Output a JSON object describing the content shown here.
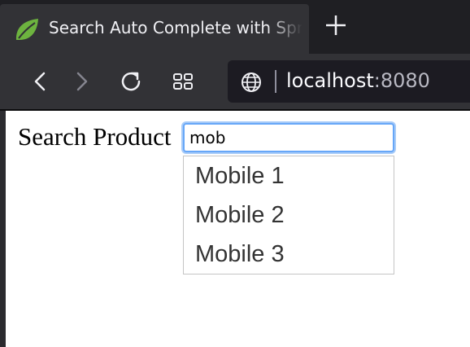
{
  "browser": {
    "tab": {
      "title": "Search Auto Complete with Spring Boot",
      "favicon": "spring-leaf-icon"
    },
    "new_tab_icon": "plus-icon",
    "toolbar": {
      "back_icon": "chevron-left-icon",
      "forward_icon": "chevron-right-icon",
      "reload_icon": "reload-icon",
      "overview_icon": "grid-icon"
    },
    "url": {
      "host": "localhost",
      "port": ":8080",
      "site_icon": "globe-icon"
    }
  },
  "page": {
    "label": "Search Product",
    "search": {
      "value": "mob"
    },
    "suggestions": [
      "Mobile 1",
      "Mobile 2",
      "Mobile 3"
    ]
  },
  "colors": {
    "tabbar_bg": "#1f1f23",
    "toolbar_bg": "#323236",
    "focus_ring": "#67a7f8",
    "suggestion_text": "#333333"
  }
}
